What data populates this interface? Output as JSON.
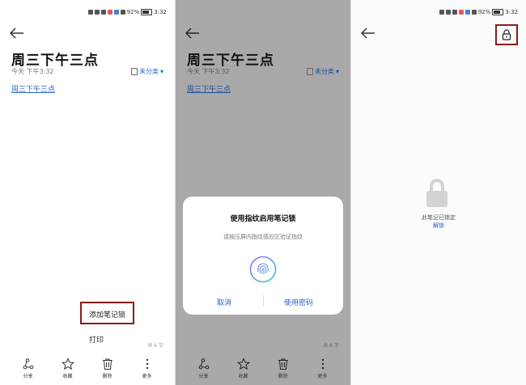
{
  "status_bar": {
    "battery": "92%",
    "time": "3:32"
  },
  "note": {
    "title": "周三下午三点",
    "meta": "今天 下午3:32",
    "category": "未分类",
    "body": "周三下午三点",
    "word_count": "共 6 字"
  },
  "menu": {
    "add_lock": "添加笔记锁",
    "print": "打印"
  },
  "toolbar": {
    "share": "分享",
    "favorite": "收藏",
    "delete": "删除",
    "more": "更多"
  },
  "dialog": {
    "title": "使用指纹启用笔记锁",
    "subtitle": "请按压屏内指纹感应区验证指纹",
    "cancel": "取消",
    "use_password": "使用密码"
  },
  "locked": {
    "message": "此笔记已锁定",
    "unlock": "解锁"
  },
  "colors": {
    "accent": "#2a63c9",
    "highlight": "#8b1a1a",
    "dim": "#a9a9a9"
  }
}
